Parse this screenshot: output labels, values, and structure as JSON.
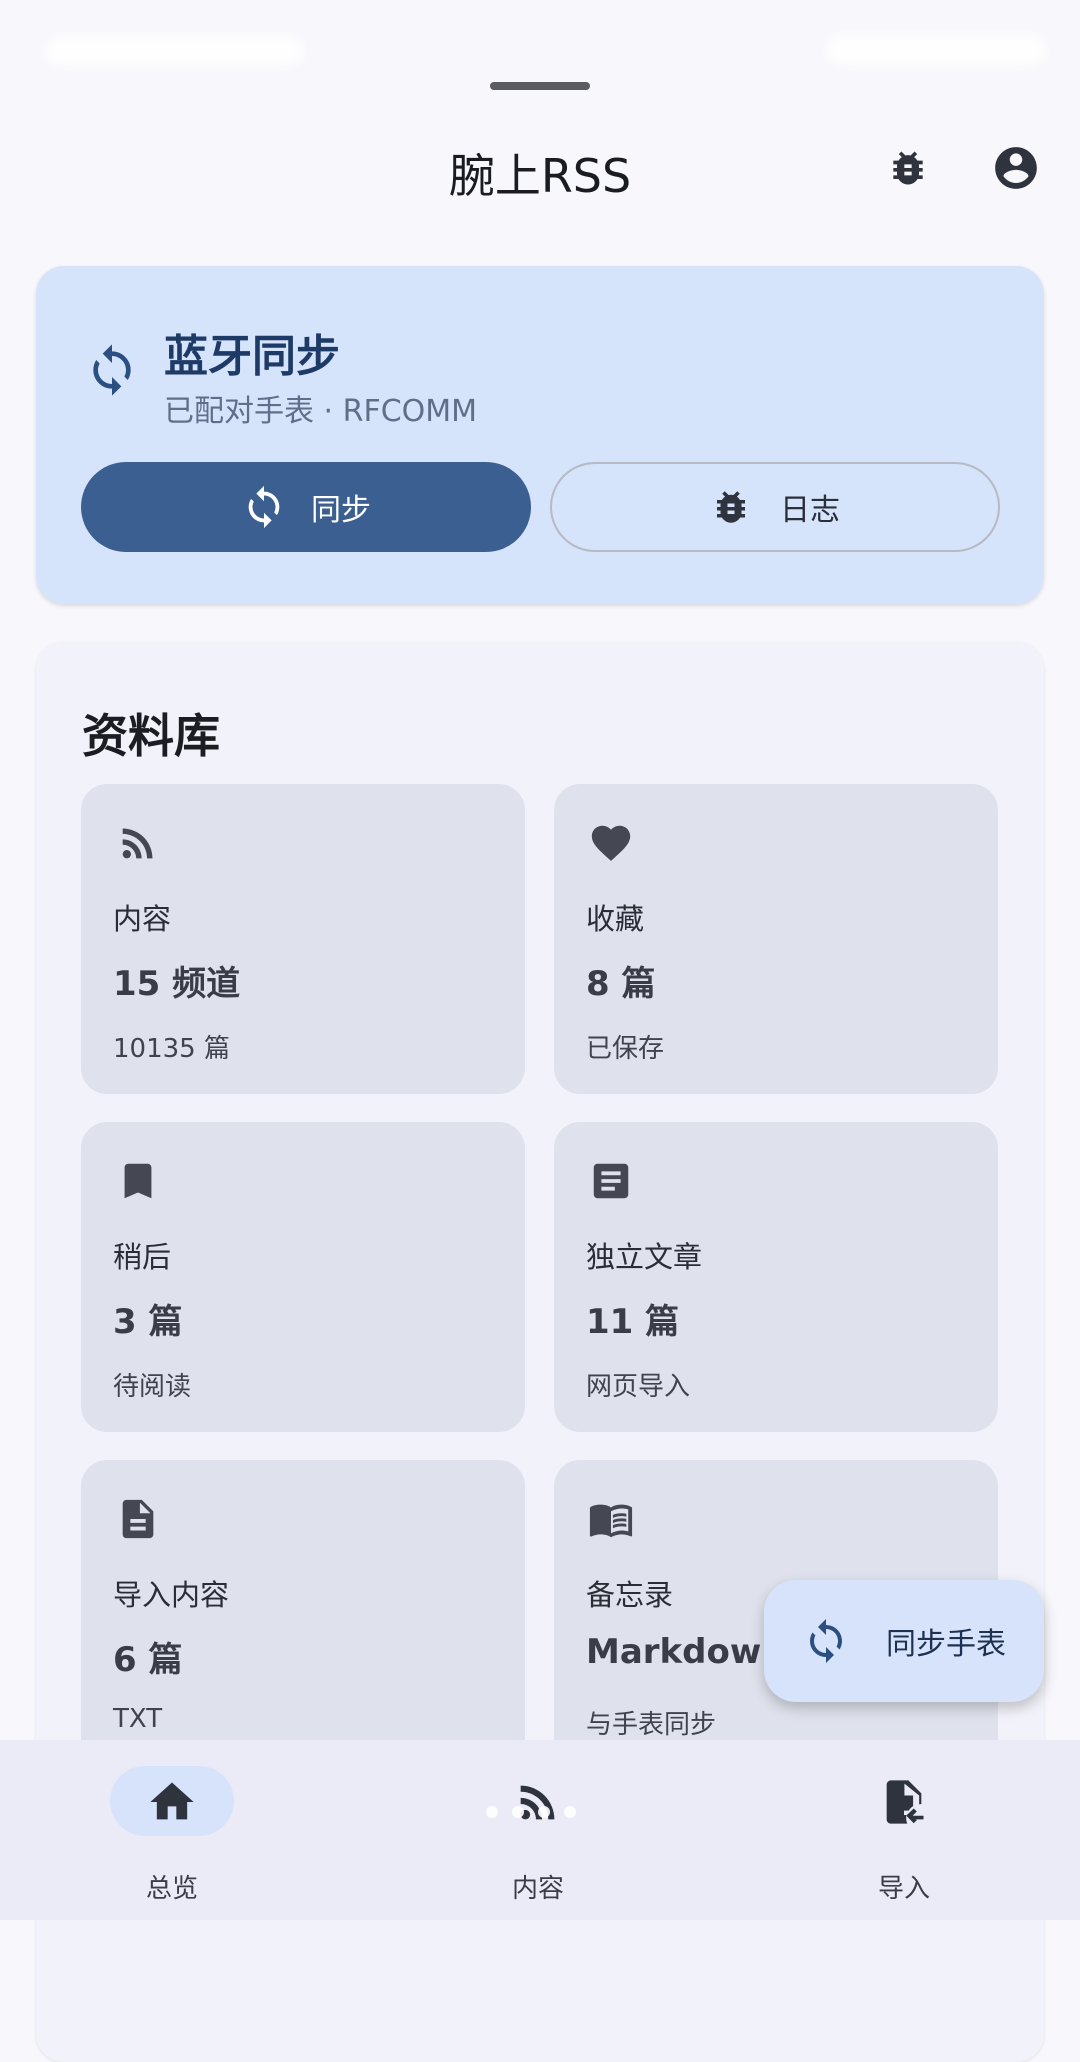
{
  "app": {
    "title": "腕上RSS"
  },
  "sync": {
    "title": "蓝牙同步",
    "subtitle": "已配对手表 · RFCOMM",
    "sync_button": "同步",
    "log_button": "日志"
  },
  "library": {
    "title": "资料库",
    "tiles": [
      {
        "icon": "rss-icon",
        "label": "内容",
        "value": "15 频道",
        "sub": "10135 篇"
      },
      {
        "icon": "heart-icon",
        "label": "收藏",
        "value": "8 篇",
        "sub": "已保存"
      },
      {
        "icon": "bookmark-icon",
        "label": "稍后",
        "value": "3 篇",
        "sub": "待阅读"
      },
      {
        "icon": "article-icon",
        "label": "独立文章",
        "value": "11 篇",
        "sub": "网页导入"
      },
      {
        "icon": "file-icon",
        "label": "导入内容",
        "value": "6 篇",
        "sub": "TXT"
      },
      {
        "icon": "book-icon",
        "label": "备忘录",
        "value": "Markdown",
        "sub": "与手表同步"
      }
    ]
  },
  "fab": {
    "label": "同步手表"
  },
  "nav": {
    "items": [
      {
        "label": "总览",
        "icon": "home-icon",
        "active": true
      },
      {
        "label": "内容",
        "icon": "rss-icon",
        "active": false
      },
      {
        "label": "导入",
        "icon": "file-import-icon",
        "active": false
      }
    ]
  },
  "colors": {
    "primary": "#3c5f91",
    "container": "#d5e3fb",
    "tile": "#dfe2ec",
    "background": "#f7f7fc"
  }
}
